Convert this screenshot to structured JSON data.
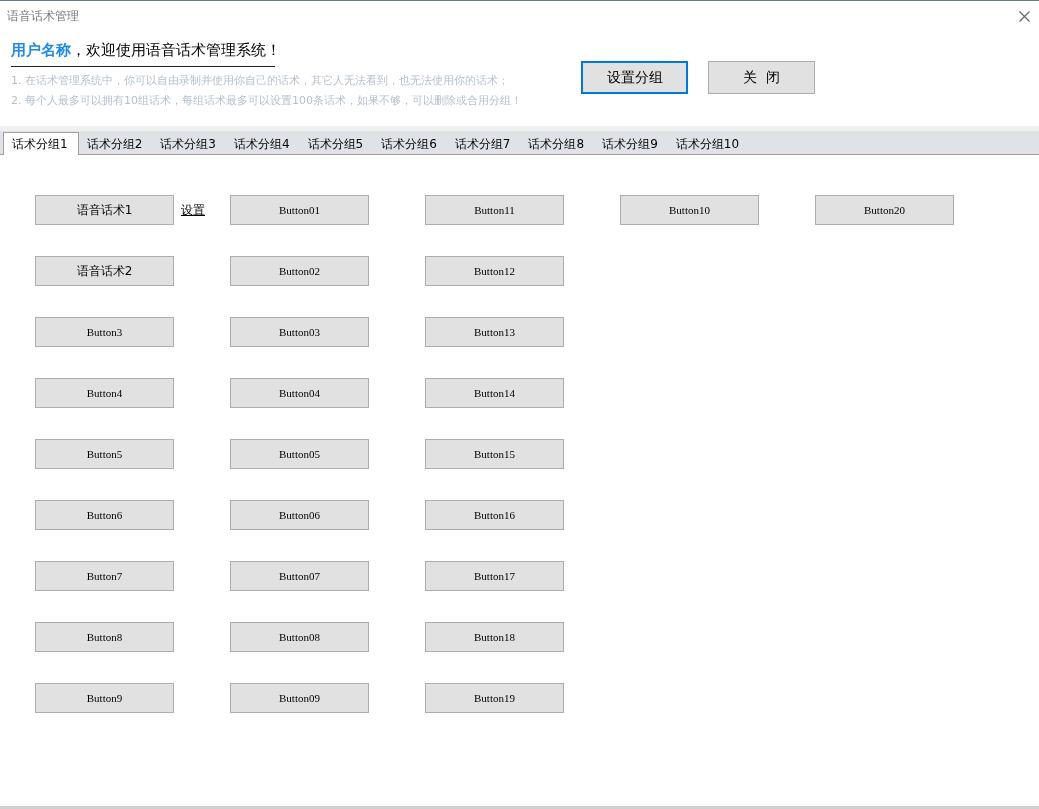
{
  "window": {
    "title": "语音话术管理"
  },
  "header": {
    "user_name": "用户名称",
    "welcome": "，欢迎使用语音话术管理系统！",
    "notes": [
      "1. 在话术管理系统中，你可以自由录制并使用你自己的话术，其它人无法看到，也无法使用你的话术；",
      "2. 每个人最多可以拥有10组话术，每组话术最多可以设置100条话术，如果不够，可以删除或合用分组！"
    ],
    "buttons": [
      {
        "label": "设置分组",
        "focused": true
      },
      {
        "label": "关  闭",
        "focused": false
      }
    ]
  },
  "tabs": [
    {
      "label": "话术分组1",
      "selected": true
    },
    {
      "label": "话术分组2",
      "selected": false
    },
    {
      "label": "话术分组3",
      "selected": false
    },
    {
      "label": "话术分组4",
      "selected": false
    },
    {
      "label": "话术分组5",
      "selected": false
    },
    {
      "label": "话术分组6",
      "selected": false
    },
    {
      "label": "话术分组7",
      "selected": false
    },
    {
      "label": "话术分组8",
      "selected": false
    },
    {
      "label": "话术分组9",
      "selected": false
    },
    {
      "label": "话术分组10",
      "selected": false
    }
  ],
  "columns": [
    {
      "items": [
        {
          "label": "语音话术1",
          "link": "设置"
        },
        {
          "label": "语音话术2"
        },
        {
          "label": "Button3"
        },
        {
          "label": "Button4"
        },
        {
          "label": "Button5"
        },
        {
          "label": "Button6"
        },
        {
          "label": "Button7"
        },
        {
          "label": "Button8"
        },
        {
          "label": "Button9"
        }
      ]
    },
    {
      "items": [
        {
          "label": "Button01"
        },
        {
          "label": "Button02"
        },
        {
          "label": "Button03"
        },
        {
          "label": "Button04"
        },
        {
          "label": "Button05"
        },
        {
          "label": "Button06"
        },
        {
          "label": "Button07"
        },
        {
          "label": "Button08"
        },
        {
          "label": "Button09"
        }
      ]
    },
    {
      "items": [
        {
          "label": "Button11"
        },
        {
          "label": "Button12"
        },
        {
          "label": "Button13"
        },
        {
          "label": "Button14"
        },
        {
          "label": "Button15"
        },
        {
          "label": "Button16"
        },
        {
          "label": "Button17"
        },
        {
          "label": "Button18"
        },
        {
          "label": "Button19"
        }
      ]
    },
    {
      "items": [
        {
          "label": "Button10"
        }
      ]
    },
    {
      "items": [
        {
          "label": "Button20"
        }
      ]
    }
  ]
}
